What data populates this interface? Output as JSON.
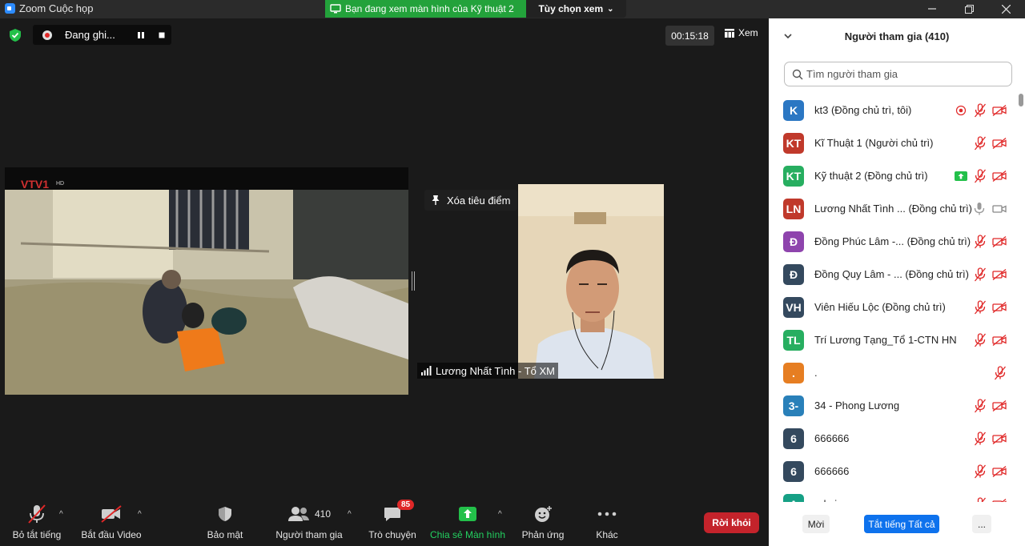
{
  "window": {
    "title": "Zoom Cuộc họp",
    "share_banner": "Bạn đang xem màn hình của Kỹ thuật 2",
    "view_options": "Tùy chọn xem"
  },
  "meeting_top": {
    "recording_label": "Đang ghi...",
    "timer": "00:15:18",
    "view_label": "Xem"
  },
  "video": {
    "unpin_label": "Xóa tiêu điểm",
    "speaker_name": "Lương Nhất Tình - Tổ XM"
  },
  "toolbar": {
    "mute_label": "Bỏ tắt tiếng",
    "video_label": "Bắt đầu Video",
    "security_label": "Bảo mật",
    "participants_label": "Người tham gia",
    "participants_count": "410",
    "chat_label": "Trò chuyện",
    "chat_badge": "85",
    "share_label": "Chia sẻ Màn hình",
    "reactions_label": "Phản ứng",
    "more_label": "Khác",
    "leave_label": "Rời khỏi",
    "share_color": "#23d160",
    "leave_color": "#c4232b"
  },
  "participants_panel": {
    "title": "Người tham gia (410)",
    "search_placeholder": "Tìm người tham gia",
    "participants": [
      {
        "initials": "K",
        "name": "kt3 (Đồng chủ trì, tôi)",
        "color": "#2b77c3",
        "status": "recording"
      },
      {
        "initials": "KT",
        "name": "Kĩ Thuật 1 (Người chủ trì)",
        "color": "#c0392b",
        "status": ""
      },
      {
        "initials": "KT",
        "name": "Kỹ thuật 2 (Đồng chủ trì)",
        "color": "#27ae60",
        "status": "sharing"
      },
      {
        "initials": "LN",
        "name": "Lương Nhất Tình ... (Đồng chủ trì)",
        "color": "#c0392b",
        "status": "live"
      },
      {
        "initials": "Đ",
        "name": "Đồng Phúc Lâm -... (Đồng chủ trì)",
        "color": "#8e44ad",
        "status": ""
      },
      {
        "initials": "Đ",
        "name": "Đồng Quy Lâm - ... (Đồng chủ trì)",
        "color": "#34495e",
        "status": ""
      },
      {
        "initials": "VH",
        "name": "Viên Hiếu Lộc (Đồng chủ trì)",
        "color": "#34495e",
        "status": ""
      },
      {
        "initials": "TL",
        "name": " Trí Lương Tạng_Tổ 1-CTN HN",
        "color": "#27ae60",
        "status": ""
      },
      {
        "initials": ".",
        "name": ".",
        "color": "#e67e22",
        "status": "audio-only"
      },
      {
        "initials": "3-",
        "name": "34 - Phong Lương",
        "color": "#2980b9",
        "status": ""
      },
      {
        "initials": "6",
        "name": "666666",
        "color": "#34495e",
        "status": ""
      },
      {
        "initials": "6",
        "name": "666666",
        "color": "#34495e",
        "status": ""
      },
      {
        "initials": "A",
        "name": "admin",
        "color": "#16a085",
        "status": ""
      }
    ],
    "invite_label": "Mời",
    "mute_all_label": "Tắt tiếng Tất cả",
    "more_label": "..."
  }
}
